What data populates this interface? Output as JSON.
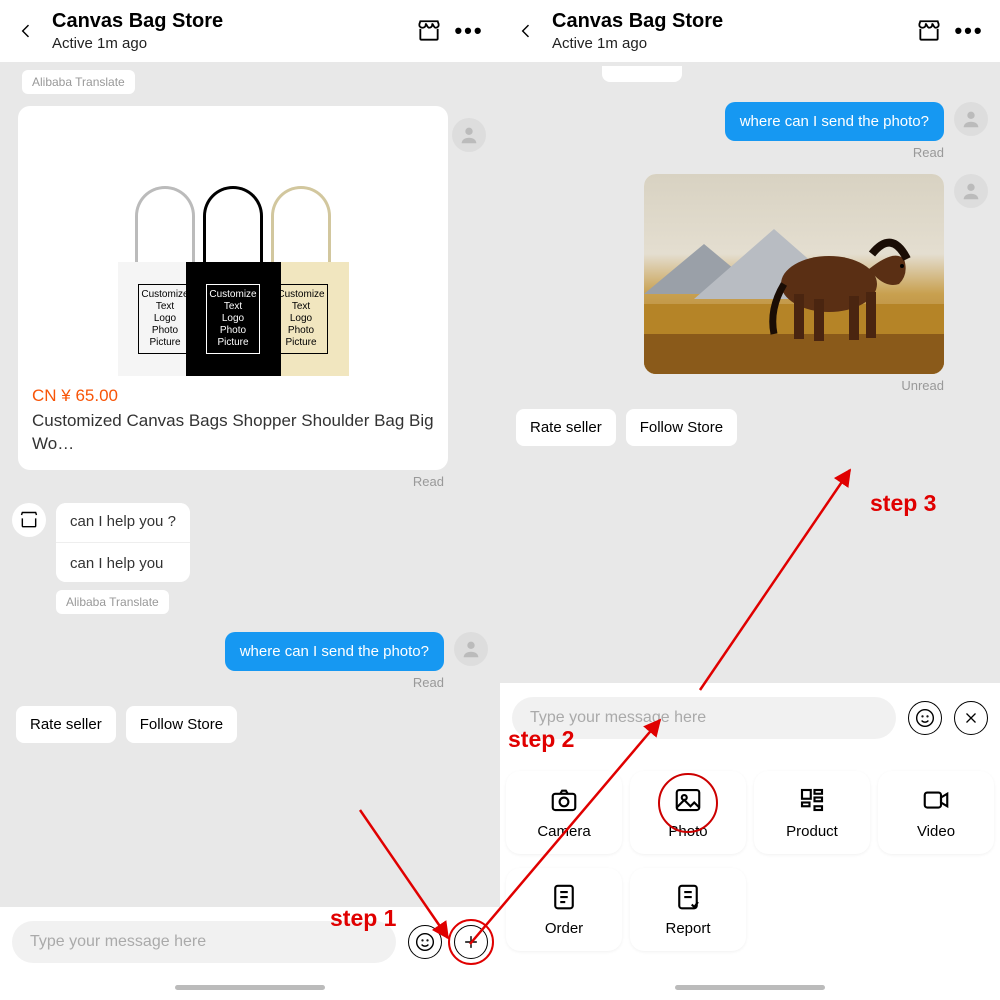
{
  "header": {
    "title": "Canvas Bag Store",
    "subtitle": "Active 1m ago"
  },
  "translate_pill": "Alibaba Translate",
  "product": {
    "bag_text": "Customize\nText\nLogo\nPhoto\nPicture",
    "price": "CN ¥  65.00",
    "title": "Customized Canvas Bags Shopper Shoulder Bag Big Wo…"
  },
  "seller": {
    "msg1": "can I help you ?",
    "msg2": "can I help you",
    "translate": "Alibaba Translate"
  },
  "user_msg": "where can I send the photo?",
  "status": {
    "read": "Read",
    "unread": "Unread"
  },
  "chips": {
    "rate": "Rate seller",
    "follow": "Follow Store"
  },
  "input_placeholder": "Type your message here",
  "attach": {
    "camera": "Camera",
    "photo": "Photo",
    "product": "Product",
    "video": "Video",
    "order": "Order",
    "report": "Report"
  },
  "steps": {
    "s1": "step 1",
    "s2": "step 2",
    "s3": "step 3"
  }
}
